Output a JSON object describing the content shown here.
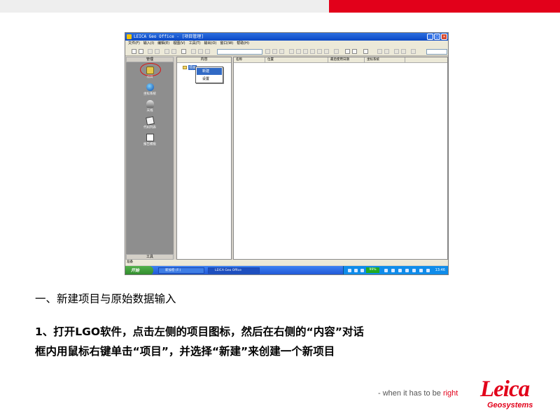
{
  "window": {
    "title": "LEICA Geo Office - [项目管理]",
    "minimize": "_",
    "maximize": "□",
    "close": "×"
  },
  "menu": [
    "文件(F)",
    "输入(I)",
    "编辑(E)",
    "视图(V)",
    "工具(T)",
    "输出(O)",
    "窗口(W)",
    "帮助(H)"
  ],
  "left_pane": {
    "header": "管理",
    "footer": "工具",
    "items": [
      {
        "label": "项目",
        "icon": "project-icon"
      },
      {
        "label": "坐标系统",
        "icon": "globe-icon"
      },
      {
        "label": "天线",
        "icon": "antenna-icon"
      },
      {
        "label": "代码列表",
        "icon": "code-list-icon"
      },
      {
        "label": "报告模板",
        "icon": "report-template-icon"
      }
    ]
  },
  "tree": {
    "header": "内容",
    "root_label": "项目"
  },
  "context_menu": {
    "items": [
      "新建",
      "设置"
    ]
  },
  "list": {
    "columns": [
      "名称",
      "位置",
      "最后使用日期",
      "坐标系统"
    ]
  },
  "status": {
    "text": "准备"
  },
  "taskbar": {
    "start": "开始",
    "tasks": [
      "新加卷 (F:)",
      "LEICA Geo Office"
    ],
    "tray_box": "99%",
    "clock": "13:46"
  },
  "slide": {
    "heading": "一、新建项目与原始数据输入",
    "paragraph_lines": [
      "1、打开LGO软件，点击左侧的项目图标，然后在右侧的“内容”对话",
      "框内用鼠标右键单击“项目”，并选择“新建”来创建一个新项目"
    ]
  },
  "footer": {
    "tagline_prefix": "- when it has to be ",
    "tagline_emphasis": "right",
    "logo_name": "Leica",
    "logo_sub": "Geosystems"
  },
  "colors": {
    "brand_red": "#e2001a",
    "top_gray": "#eeeeee",
    "xp_blue": "#0a47c4"
  }
}
